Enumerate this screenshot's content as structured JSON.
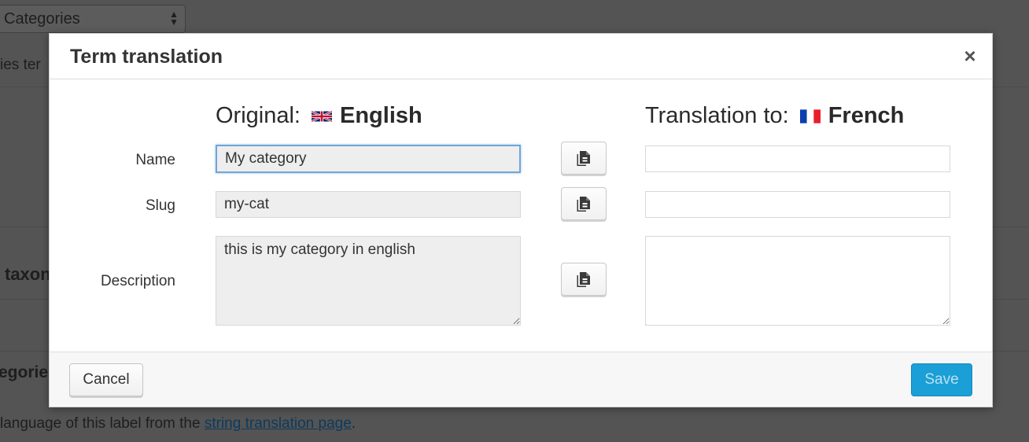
{
  "background": {
    "select_value": "Categories",
    "text_fragment_1": "ies ter",
    "heading_fragment": "taxon",
    "heading_fragment_2": "egories",
    "help_text_prefix": "language of this label from the ",
    "help_link": "string translation page",
    "help_text_suffix": "."
  },
  "dialog": {
    "title": "Term translation",
    "close_symbol": "×",
    "original": {
      "prefix": "Original:",
      "language": "English",
      "flag": "uk-flag-icon"
    },
    "translation": {
      "prefix": "Translation to:",
      "language": "French",
      "flag": "fr-flag-icon"
    },
    "fields": {
      "name": {
        "label": "Name",
        "original": "My category",
        "translation": ""
      },
      "slug": {
        "label": "Slug",
        "original": "my-cat",
        "translation": ""
      },
      "description": {
        "label": "Description",
        "original": "this is my category in english",
        "translation": ""
      }
    },
    "copy_icon": "copy-icon",
    "cancel_label": "Cancel",
    "save_label": "Save"
  },
  "colors": {
    "overlay": "#545454",
    "save_button": "#1a9fd6",
    "focus_border": "#6ea6d9",
    "original_field_bg": "#eeeeee"
  }
}
